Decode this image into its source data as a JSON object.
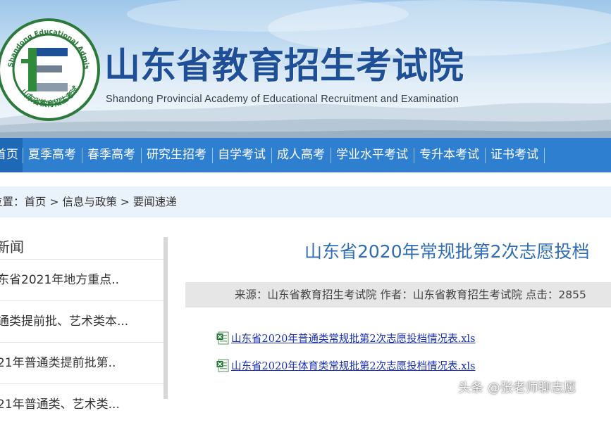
{
  "header": {
    "title": "山东省教育招生考试院",
    "subtitle": "Shandong Provincial Academy of Educational Recruitment and Examination",
    "emblem": {
      "ring_text": "Shandong Educational Admission & Examinations",
      "bottom_text": "山东省教育招生考试",
      "letter": "E"
    }
  },
  "nav": {
    "items": [
      {
        "label": "首页",
        "active": true
      },
      {
        "label": "夏季高考"
      },
      {
        "label": "春季高考"
      },
      {
        "label": "研究生招考"
      },
      {
        "label": "自学考试"
      },
      {
        "label": "成人高考"
      },
      {
        "label": "学业水平考试"
      },
      {
        "label": "专升本考试"
      },
      {
        "label": "证书考试"
      }
    ]
  },
  "breadcrumb": {
    "lead": "位置：",
    "items": [
      "首页",
      "信息与政策",
      "要闻速递"
    ],
    "separator": " > "
  },
  "sidebar": {
    "heading": "新闻",
    "items": [
      "东省2021年地方重点..",
      "通类提前批、艺术类本...",
      "21年普通类提前批第..",
      "21年普通类、艺术类..."
    ]
  },
  "article": {
    "title": "山东省2020年常规批第2次志愿投档",
    "meta": "来源：山东省教育招生考试院 作者：山东省教育招生考试院 点击：2855",
    "attachments": [
      "山东省2020年普通类常规批第2次志愿投档情况表.xls",
      "山东省2020年体育类常规批第2次志愿投档情况表.xls"
    ]
  },
  "watermark": "头条 @张老师聊志愿",
  "colors": {
    "nav_bg": "#2f7fd0",
    "title_blue": "#1f4f97",
    "link": "#1a2fb4",
    "article_title": "#2f6db5"
  }
}
